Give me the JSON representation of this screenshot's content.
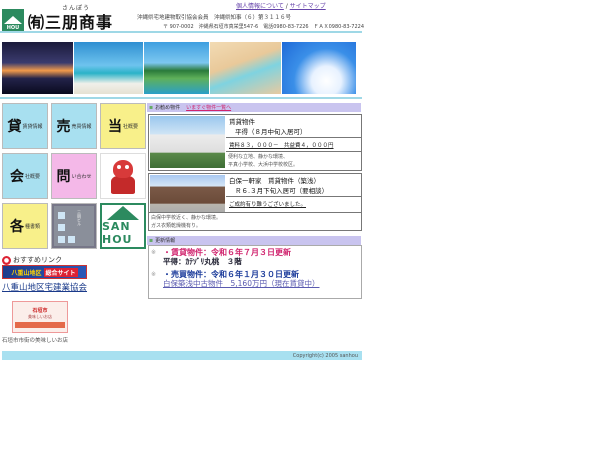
{
  "header": {
    "logo_text": "HOU",
    "ruby": "さんぽう",
    "company_name": "㈲三朋商事",
    "links": {
      "privacy": "個人情報について",
      "sep": " / ",
      "sitemap": "サイトマップ"
    },
    "member_line": "沖縄県宅地建物取引協会会員　沖縄県知事（６）第３１１６号",
    "address_line": "〒 907-0002　沖縄県石垣市真栄里547-6　電話0980-83-7226　ＦＡＸ0980-83-7224"
  },
  "menu": {
    "rent": {
      "big": "貸",
      "small": "賃貸情報"
    },
    "sale": {
      "big": "売",
      "small": "売買情報"
    },
    "company": {
      "big": "当",
      "small": "社概要"
    },
    "about": {
      "big": "会",
      "small": "社概要"
    },
    "inquiry": {
      "big": "問",
      "small": "い合わせ"
    },
    "misc": {
      "big": "各",
      "small": "種書類"
    },
    "building_caption": "三朋ビル",
    "sanhou_logo": "SAN HOU"
  },
  "recommend": {
    "label": "おすすめリンク",
    "banner_text": "八重山地区",
    "banner_tag": "総合サイト",
    "association": "八重山地区宅建業協会",
    "shop_banner_l1": "石垣市",
    "shop_banner_l2": "美味しいお店",
    "shop_caption": "石垣市市街の美味しいお店"
  },
  "recommended_panel": {
    "title": "お勧め物件",
    "link": "いますぐ物件一覧へ",
    "properties": [
      {
        "title_line1": "賃貸物件",
        "title_line2": "平得（８月中旬入居可）",
        "price": "賃料８３，０００－　共益費４，０００円",
        "note_line1": "便利な立地、静かな環境、",
        "note_line2": "平真小学校、大浜中学校校区。"
      },
      {
        "title_line1": "白保一軒家　賃貸物件（築浅）",
        "title_line2": "Ｒ６.３月下旬入居可（要相談）",
        "price": "ご成約有り難うございました。",
        "note_line1": "白保中学校近く、静かな環境。",
        "note_line2": "ガス衣類乾燥機有り。"
      }
    ]
  },
  "update_panel": {
    "title": "更新情報",
    "items": [
      {
        "headline": "・賃貸物件：令和６年７月３日更新",
        "detail": "平得：ｶﾃｿﾞﾘ丸桃　３階"
      },
      {
        "headline": "・売買物件：令和６年１月３０日更新",
        "detail": "白保築浅中古物件　5,160万円（現在賃貸中）"
      }
    ]
  },
  "footer": {
    "copyright": "Copyright(c) 2005 sanhou"
  },
  "colors": {
    "accent_green": "#2c8a5f",
    "light_blue": "#a8e0f0",
    "panel_header": "#c9c4ef",
    "link_pink": "#d0246e"
  }
}
